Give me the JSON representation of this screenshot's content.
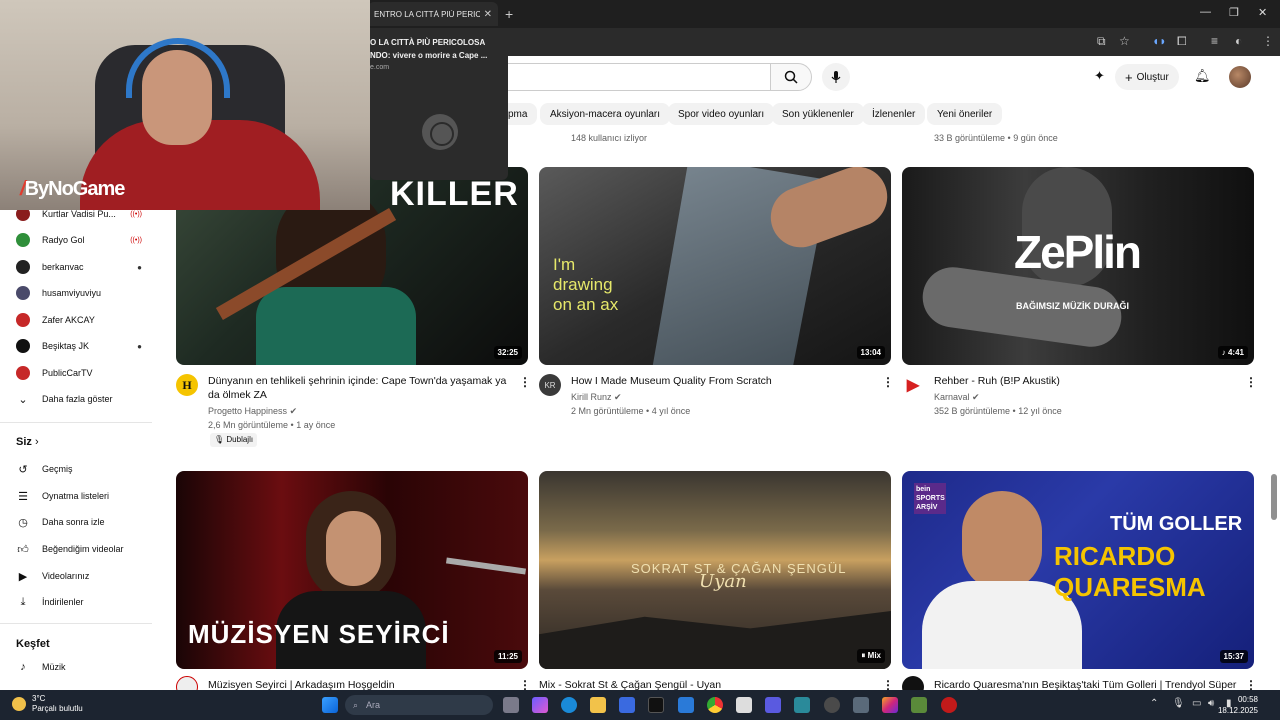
{
  "browser": {
    "tab_title": "ENTRO LA CITTÀ PIÙ PERICOLOSA",
    "preview_title_line1": "O LA CITTÀ PIÙ PERICOLOSA",
    "preview_title_line2": "NDO: vivere o morire a Cape ...",
    "preview_domain": "e.com"
  },
  "header": {
    "create_label": "Oluştur"
  },
  "chips": [
    "pma",
    "Aksiyon-macera oyunları",
    "Spor video oyunları",
    "Son yüklenenler",
    "İzlenenler",
    "Yeni öneriler"
  ],
  "top_row": {
    "left_meta": "148 kullanıcı izliyor",
    "right_meta": "33 B görüntüleme • 9 gün önce"
  },
  "sidebar": {
    "subscriptions": [
      {
        "label": "Kurtlar Vadisi Pu...",
        "indicator": "live",
        "color": "#8a1d1d"
      },
      {
        "label": "Radyo Gol",
        "indicator": "live",
        "color": "#2f8f3a"
      },
      {
        "label": "berkanvac",
        "indicator": "dot",
        "color": "#222222"
      },
      {
        "label": "husamviyuviyu",
        "indicator": "",
        "color": "#4a4a6a"
      },
      {
        "label": "Zafer AKCAY",
        "indicator": "",
        "color": "#c62828"
      },
      {
        "label": "Beşiktaş JK",
        "indicator": "dot",
        "color": "#111111"
      },
      {
        "label": "PublicCarTV",
        "indicator": "",
        "color": "#c62828"
      }
    ],
    "show_more": "Daha fazla göster",
    "you_header": "Siz",
    "you_items": [
      {
        "label": "Geçmiş",
        "icon": "history-icon"
      },
      {
        "label": "Oynatma listeleri",
        "icon": "playlist-icon"
      },
      {
        "label": "Daha sonra izle",
        "icon": "watch-later-icon"
      },
      {
        "label": "Beğendiğim videolar",
        "icon": "like-icon"
      },
      {
        "label": "Videolarınız",
        "icon": "your-videos-icon"
      },
      {
        "label": "İndirilenler",
        "icon": "download-icon"
      }
    ],
    "explore_header": "Keşfet",
    "explore_items": [
      {
        "label": "Müzik",
        "icon": "music-icon"
      }
    ]
  },
  "videos": [
    {
      "title": "Dünyanın en tehlikeli şehrinin içinde: Cape Town'da yaşamak ya da ölmek ZA",
      "title_line1": "Dünyanın en tehlikeli şehrinin içinde: Cape Town'da yaşamak ya",
      "title_line2": "da ölmek ZA",
      "channel": "Progetto Happiness",
      "stats": "2,6 Mn görüntüleme • 1 ay önce",
      "badge": "Dublajlı",
      "duration": "32:25",
      "thumb_text": "KILLER"
    },
    {
      "title": "How I Made Museum Quality From Scratch",
      "channel": "Kirill Runz",
      "stats": "2 Mn görüntüleme • 4 yıl önce",
      "duration": "13:04",
      "thumb_text": "I'm drawing on an ax"
    },
    {
      "title": "Rehber - Ruh (B!P Akustik)",
      "channel": "Karnaval",
      "stats": "352 B görüntüleme • 12 yıl önce",
      "duration": "4:41",
      "thumb_text": "ZePlin",
      "thumb_sub": "BAĞIMSIZ MÜZİK DURAĞI"
    },
    {
      "title": "Müzisyen Seyirci | Arkadaşım Hoşgeldin",
      "duration": "11:25",
      "thumb_text": "MÜZİSYEN SEYİRCİ"
    },
    {
      "title": "Mix - Sokrat St & Çağan Şengül - Uyan",
      "duration": "Mix",
      "thumb_text": "SOKRAT ST & ÇAĞAN ŞENGÜL",
      "thumb_script": "Uyan"
    },
    {
      "title": "Ricardo Quaresma'nın Beşiktaş'taki Tüm Golleri | Trendyol Süper",
      "duration": "15:37",
      "thumb_text1": "TÜM GOLLER",
      "thumb_text2": "RICARDO QUARESMA",
      "thumb_badge": "bein SPORTS ARŞİV"
    }
  ],
  "webcam": {
    "logo": "ByNoGame"
  },
  "taskbar": {
    "temp": "3°C",
    "weather": "Parçalı bulutlu",
    "search_placeholder": "Ara",
    "time": "00:58",
    "date": "18.12.2025"
  }
}
